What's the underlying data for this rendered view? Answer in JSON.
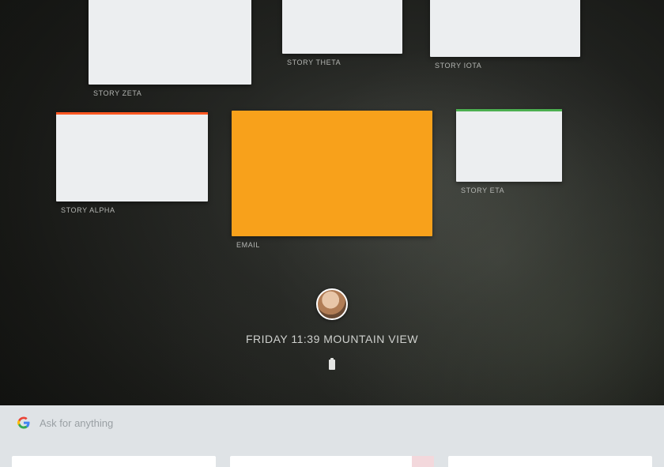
{
  "stories": {
    "zeta": {
      "label": "STORY ZETA"
    },
    "theta": {
      "label": "STORY THETA"
    },
    "iota": {
      "label": "STORY IOTA"
    },
    "alpha": {
      "label": "STORY ALPHA",
      "accent": "#ff5722"
    },
    "email": {
      "label": "EMAIL",
      "bg": "#f8a11b",
      "inner_text": ""
    },
    "eta": {
      "label": "STORY ETA",
      "accent": "#4caf50"
    }
  },
  "status": {
    "day": "FRIDAY",
    "time": "11:39",
    "location": "MOUNTAIN VIEW",
    "line": "FRIDAY 11:39 MOUNTAIN VIEW"
  },
  "search": {
    "placeholder": "Ask for anything"
  }
}
